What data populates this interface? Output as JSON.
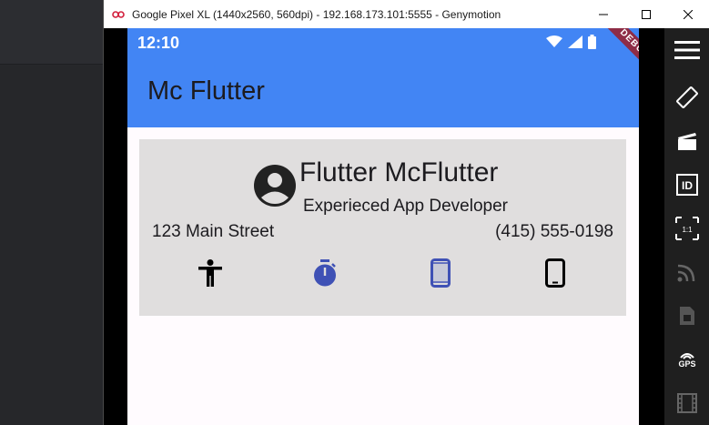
{
  "window": {
    "title": "Google Pixel XL (1440x2560, 560dpi) - 192.168.173.101:5555 - Genymotion",
    "controls": [
      "minimize-icon",
      "maximize-icon",
      "close-icon"
    ]
  },
  "status_bar": {
    "time": "12:10",
    "icons": [
      "wifi-icon",
      "signal-icon",
      "battery-icon"
    ]
  },
  "debug_banner": "DEBUG",
  "app_bar": {
    "title": "Mc Flutter",
    "color": "#4285f4"
  },
  "card": {
    "name": "Flutter McFlutter",
    "role": "Experieced App Developer",
    "address": "123 Main Street",
    "phone": "(415) 555-0198",
    "icons": [
      {
        "name": "accessibility-icon",
        "color": "#000000"
      },
      {
        "name": "timer-icon",
        "color": "#3f51b5"
      },
      {
        "name": "smartphone-icon",
        "color": "#3f51b5"
      },
      {
        "name": "phone-android-icon",
        "color": "#000000"
      }
    ]
  },
  "toolbar": {
    "items": [
      "menu-icon",
      "rotate-icon",
      "capture-icon",
      "device-id-icon",
      "pixel-perfect-icon",
      "network-icon",
      "sim-icon",
      "gps-icon",
      "media-icon"
    ],
    "gps_label": "GPS",
    "pixel_label": "1:1"
  }
}
